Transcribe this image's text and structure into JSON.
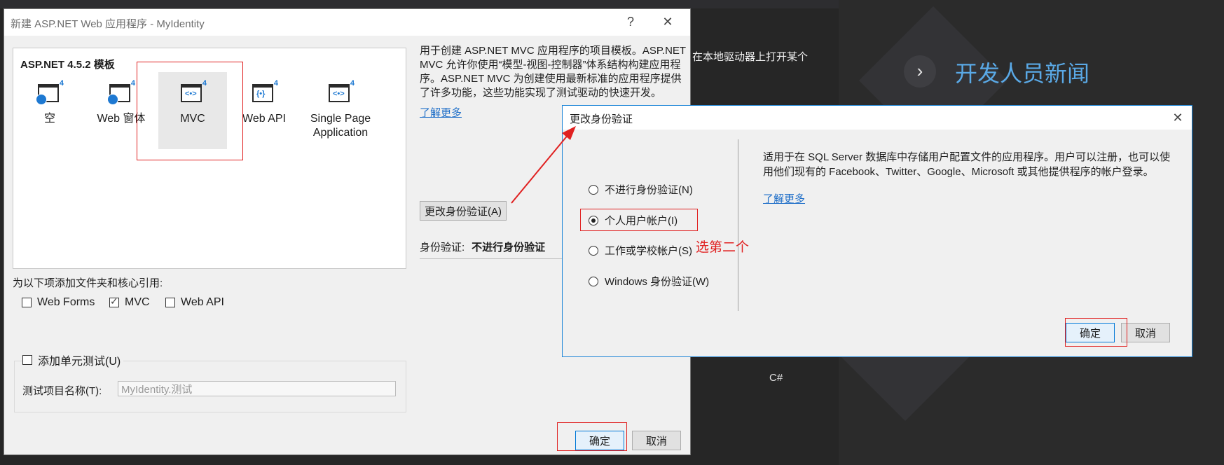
{
  "background": {
    "local_drive_text": "在本地驱动器上打开某个",
    "news_title": "开发人员新闻",
    "news_arrow": "›",
    "csharp_label": "C#"
  },
  "main_dialog": {
    "title": "新建 ASP.NET Web 应用程序 - MyIdentity",
    "help_label": "?",
    "close_label": "✕",
    "templates_heading": "ASP.NET 4.5.2 模板",
    "templates": [
      {
        "label": "空",
        "icon": "web-project-icon",
        "version": "4"
      },
      {
        "label": "Web 窗体",
        "icon": "web-forms-icon",
        "version": "4"
      },
      {
        "label": "MVC",
        "icon": "mvc-icon",
        "version": "4"
      },
      {
        "label": "Web API",
        "icon": "web-api-icon",
        "version": "4"
      },
      {
        "label": "Single Page Application",
        "icon": "spa-icon",
        "version": "4"
      }
    ],
    "selected_template": "MVC",
    "description": "用于创建 ASP.NET MVC 应用程序的项目模板。ASP.NET MVC 允许你使用“模型-视图-控制器”体系结构构建应用程序。ASP.NET MVC 为创建使用最新标准的应用程序提供了许多功能，这些功能实现了测试驱动的快速开发。",
    "learn_more": "了解更多",
    "change_auth_button": "更改身份验证(A)",
    "auth_label": "身份验证:",
    "auth_value": "不进行身份验证",
    "folders_label": "为以下项添加文件夹和核心引用:",
    "folder_options": [
      {
        "label": "Web Forms",
        "checked": false
      },
      {
        "label": "MVC",
        "checked": true
      },
      {
        "label": "Web API",
        "checked": false
      }
    ],
    "unit_test_label": "添加单元测试(U)",
    "unit_test_checked": false,
    "test_project_label": "测试项目名称(T):",
    "test_project_value": "MyIdentity.测试",
    "ok_button": "确定",
    "cancel_button": "取消"
  },
  "auth_dialog": {
    "title": "更改身份验证",
    "close_label": "✕",
    "options": [
      {
        "label": "不进行身份验证(N)",
        "selected": false
      },
      {
        "label": "个人用户帐户(I)",
        "selected": true
      },
      {
        "label": "工作或学校帐户(S)",
        "selected": false
      },
      {
        "label": "Windows 身份验证(W)",
        "selected": false
      }
    ],
    "description": "适用于在 SQL Server 数据库中存储用户配置文件的应用程序。用户可以注册，也可以使用他们现有的 Facebook、Twitter、Google、Microsoft 或其他提供程序的帐户登录。",
    "learn_more": "了解更多",
    "ok_button": "确定",
    "cancel_button": "取消"
  },
  "annotations": {
    "note": "选第二个",
    "color": "#e02020"
  }
}
